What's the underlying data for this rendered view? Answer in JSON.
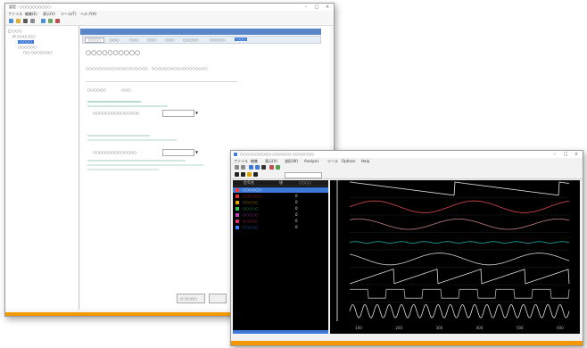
{
  "config_window": {
    "title": "設定 - ○○○○○○○○○○",
    "menu": [
      "ファイル",
      "編集(E)",
      "表示(V)",
      "ツール(T)",
      "ヘルプ(H)"
    ],
    "tree": [
      "□ ○○○",
      "☑ ○○○○○○",
      "○○○○",
      "○○○○○○",
      "○○ ○○○○○○○"
    ],
    "tabs": [
      "○○○○",
      "○○○",
      "○○○",
      "○○○",
      "○○○",
      "○○○○○",
      "○○○○○",
      "○○○"
    ],
    "heading": "○○○○○○○○○○",
    "description": "○○○○○○○○○○○○○○○○○○○○　○○○○○○○○○○○○○○○○○○",
    "field1_label": "○○○○○○",
    "field1_value": "○○○",
    "field2_label": "○○○○○○○○○○○○○○○",
    "field3_label": "○○○○○○○○○○○○○○",
    "footer_button": "○ ○○○○",
    "accent_color": "#f39800"
  },
  "scope_window": {
    "title": "○○○○○○○○○○ ○○○○○○ ○○○○○○○",
    "menu": [
      "ファイル",
      "編集",
      "表示(V)",
      "波形(W)",
      "Analysis",
      "ツール",
      "Options",
      "Help"
    ],
    "grid_headers": [
      "信号名",
      "値",
      "○○○○"
    ],
    "channels": [
      {
        "name": "○○○○○○",
        "value": "",
        "color": "#ff3b3b",
        "selected": true
      },
      {
        "name": "○○○○○○",
        "value": "0",
        "color": "#e03030"
      },
      {
        "name": "○○○○○",
        "value": "0",
        "color": "#e0a000"
      },
      {
        "name": "○○○○○",
        "value": "0",
        "color": "#30c060"
      },
      {
        "name": "○○○○○",
        "value": "0",
        "color": "#c040c0"
      },
      {
        "name": "○○○○○",
        "value": "0",
        "color": "#e03070"
      },
      {
        "name": "○○○○○",
        "value": "0",
        "color": "#3080ff"
      }
    ],
    "time_axis": [
      "100",
      "200",
      "300",
      "400",
      "500",
      "600"
    ],
    "wave_colors": [
      "#e8e8e8",
      "#e04848",
      "#c08080",
      "#20a8a0",
      "#d0d0d0",
      "#e0e0e0",
      "#b0b0b0",
      "#e0e0e0"
    ],
    "accent_color": "#f39800"
  }
}
